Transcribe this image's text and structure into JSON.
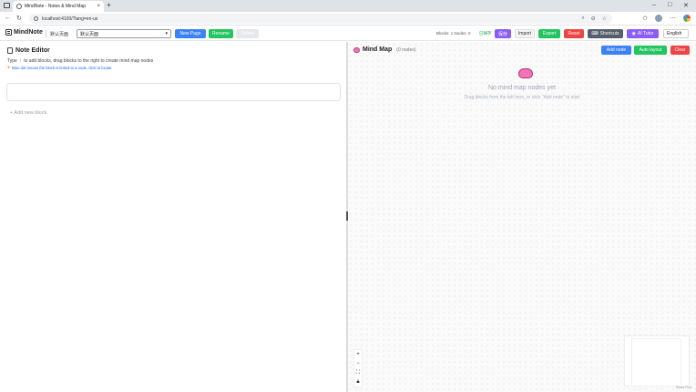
{
  "browser": {
    "tab_title": "MindNote - Notes & Mind Map",
    "url": "localhost:4100/?lang=en-us"
  },
  "app": {
    "brand": "MindNote",
    "page_label": "默认页面",
    "page_select_value": "默认页面",
    "buttons": {
      "new_page": "New Page",
      "rename": "Rename",
      "delete": "Delete",
      "save": "保存",
      "import": "Import",
      "export": "Export",
      "reset": "Reset",
      "shortcuts": "Shortcuts",
      "ai_tutor": "AI Tutor"
    },
    "stats": "Blocks: 1  Nodes: 0",
    "saved_status": "已保存",
    "language": "English"
  },
  "note_editor": {
    "title": "Note Editor",
    "hint_prefix": "Type",
    "hint_slash": "/",
    "hint_suffix": "to add blocks, drag blocks to the right to create mind map nodes",
    "linked_note": "Blue dot means the block is linked to a node, click to locate",
    "add_block": "+ Add new block"
  },
  "mind_map": {
    "title": "Mind Map",
    "count": "(0 nodes)",
    "add_node": "Add node",
    "auto_layout": "Auto layout",
    "clear": "Clear",
    "empty_title": "No mind map nodes yet",
    "empty_sub": "Drag blocks from the left here, or click \"Add node\" to start",
    "attribution": "React Flow"
  },
  "colors": {
    "accent_blue": "#3b82f6",
    "accent_green": "#22c55e",
    "accent_red": "#ef4444",
    "accent_purple": "#8b5cf6"
  }
}
